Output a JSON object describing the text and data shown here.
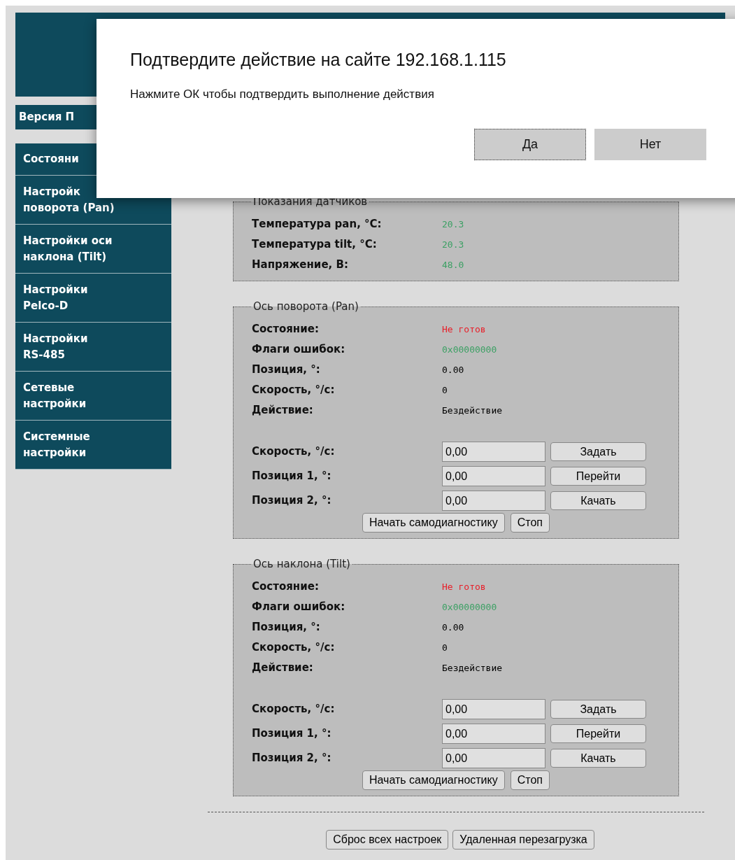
{
  "sidebar": {
    "version_label": "Версия П",
    "items": [
      {
        "label": "Состояни"
      },
      {
        "label": "Настройк\nповорота (Pan)"
      },
      {
        "label": "Настройки оси\nнаклона (Tilt)"
      },
      {
        "label": "Настройки\nPelco-D"
      },
      {
        "label": "Настройки\nRS-485"
      },
      {
        "label": "Сетевые\nнастройки"
      },
      {
        "label": "Системные\nнастройки"
      }
    ]
  },
  "sections": [
    {
      "legend": "Показания датчиков",
      "readings": [
        {
          "label": "Температура pan, °C:",
          "value": "20.3",
          "color": "#3ca064"
        },
        {
          "label": "Температура tilt, °C:",
          "value": "20.3",
          "color": "#3ca064"
        },
        {
          "label": "Напряжение, В:",
          "value": "48.0",
          "color": "#3ca064"
        }
      ]
    },
    {
      "legend": "Ось поворота (Pan)",
      "readings": [
        {
          "label": "Состояние:",
          "value": "Не готов",
          "color": "#e8202a"
        },
        {
          "label": "Флаги ошибок:",
          "value": "0x00000000",
          "color": "#3ca064"
        },
        {
          "label": "Позиция, °:",
          "value": "0.00",
          "color": "#000000"
        },
        {
          "label": "Скорость, °/с:",
          "value": "0",
          "color": "#000000"
        },
        {
          "label": "Действие:",
          "value": "Бездействие",
          "color": "#000000"
        }
      ],
      "controls": [
        {
          "label": "Скорость, °/с:",
          "value": "0,00",
          "button": "Задать"
        },
        {
          "label": "Позиция 1, °:",
          "value": "0,00",
          "button": "Перейти"
        },
        {
          "label": "Позиция 2, °:",
          "value": "0,00",
          "button": "Качать"
        }
      ],
      "actions": [
        "Начать самодиагностику",
        "Стоп"
      ]
    },
    {
      "legend": "Ось наклона (Tilt)",
      "readings": [
        {
          "label": "Состояние:",
          "value": "Не готов",
          "color": "#e8202a"
        },
        {
          "label": "Флаги ошибок:",
          "value": "0x00000000",
          "color": "#3ca064"
        },
        {
          "label": "Позиция, °:",
          "value": "0.00",
          "color": "#000000"
        },
        {
          "label": "Скорость, °/с:",
          "value": "0",
          "color": "#000000"
        },
        {
          "label": "Действие:",
          "value": "Бездействие",
          "color": "#000000"
        }
      ],
      "controls": [
        {
          "label": "Скорость, °/с:",
          "value": "0,00",
          "button": "Задать"
        },
        {
          "label": "Позиция 1, °:",
          "value": "0,00",
          "button": "Перейти"
        },
        {
          "label": "Позиция 2, °:",
          "value": "0,00",
          "button": "Качать"
        }
      ],
      "actions": [
        "Начать самодиагностику",
        "Стоп"
      ]
    }
  ],
  "footer_buttons": [
    "Сброс всех настроек",
    "Удаленная перезагрузка"
  ],
  "dialog": {
    "title": "Подтвердите действие на сайте 192.168.1.115",
    "message": "Нажмите ОК чтобы подтвердить выполнение действия",
    "buttons": [
      {
        "label": "Да",
        "focused": true
      },
      {
        "label": "Нет",
        "focused": false
      }
    ]
  }
}
